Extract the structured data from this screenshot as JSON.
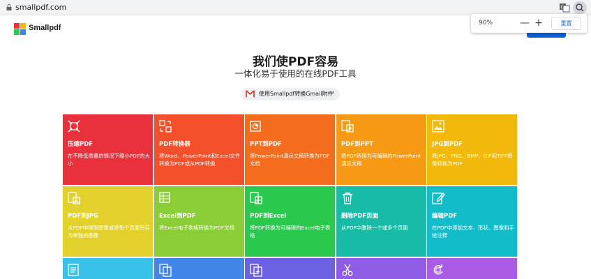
{
  "browser": {
    "url": "smallpdf.com",
    "zoom_level": "90%",
    "zoom_minus": "—",
    "zoom_plus": "+",
    "zoom_reset": "重置"
  },
  "site": {
    "logo_text": "Smallpdf",
    "brand_color": "#0a5fdd"
  },
  "hero": {
    "title": "我们使PDF容易",
    "subtitle": "一体化易于使用的在线PDF工具",
    "gmail_cta": "使用Smallpdf转换Gmail附件"
  },
  "tools": [
    {
      "title": "压缩PDF",
      "desc": "在不降低质量的情况下缩小PDF的大小",
      "color": "#e8313c",
      "icon": "compress-icon"
    },
    {
      "title": "PDF转换器",
      "desc": "将Word、PowerPoint和Excel文件转换为PDF或从PDF转换",
      "color": "#f4502c",
      "icon": "convert-icon"
    },
    {
      "title": "PPT到PDF",
      "desc": "将PowerPoint演示文稿转换为PDF文档",
      "color": "#f46d1f",
      "icon": "ppt-icon"
    },
    {
      "title": "PDF到PPT",
      "desc": "将PDF转换为可编辑的PowerPoint演示文稿",
      "color": "#f69a16",
      "icon": "pdf-to-ppt-icon"
    },
    {
      "title": "JPG到PDF",
      "desc": "将JPG、PNG、BMP、GIF和TIFF图像转换为PDF",
      "color": "#f2b80c",
      "icon": "image-icon"
    },
    {
      "title": "PDF到JPG",
      "desc": "从PDF中提取图像或将每个页面另存为单独的图像",
      "color": "#e2d12c",
      "icon": "pdf-to-jpg-icon"
    },
    {
      "title": "Excel到PDF",
      "desc": "将Excel电子表格转换为PDF文档",
      "color": "#8bcd36",
      "icon": "excel-icon"
    },
    {
      "title": "PDF到Excel",
      "desc": "将PDF转换为可编辑的Excel电子表格",
      "color": "#2bc84e",
      "icon": "pdf-to-excel-icon"
    },
    {
      "title": "删除PDF页面",
      "desc": "从PDF中删除一个或多个页面",
      "color": "#18bba6",
      "icon": "trash-icon"
    },
    {
      "title": "编辑PDF",
      "desc": "在PDF中添加文本、形状、图像和手绘注释",
      "color": "#13bcc9",
      "icon": "edit-icon"
    },
    {
      "title": "",
      "desc": "",
      "color": "#38c2ea",
      "icon": "doc-icon"
    },
    {
      "title": "",
      "desc": "",
      "color": "#3f86e8",
      "icon": "pages-icon"
    },
    {
      "title": "",
      "desc": "",
      "color": "#6b5fe2",
      "icon": "merge-icon"
    },
    {
      "title": "",
      "desc": "",
      "color": "#8f5ce6",
      "icon": "scissors-icon"
    },
    {
      "title": "",
      "desc": "",
      "color": "#a95de4",
      "icon": "rotate-icon"
    }
  ]
}
